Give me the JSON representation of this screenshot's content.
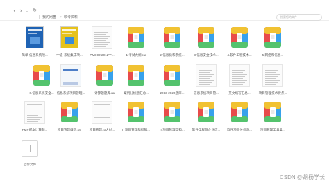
{
  "toolbar": {
    "back_icon": "chevron-left-icon",
    "forward_icon": "chevron-right-icon",
    "dropdown_icon": "chevron-down-icon",
    "refresh_icon": "refresh-icon",
    "breadcrumbs": [
      "我的网盘",
      "软考资料"
    ],
    "search_placeholder": "搜索您的文件"
  },
  "files": [
    {
      "name": "简单·信息系统项...",
      "kind": "book-cover"
    },
    {
      "name": "中级-系统集成项...",
      "kind": "book-cover"
    },
    {
      "name": "PMBOK2012中...",
      "kind": "doc-scan"
    },
    {
      "name": "1.考试大纲.rar",
      "kind": "archive"
    },
    {
      "name": "2.信息化和系统...",
      "kind": "archive"
    },
    {
      "name": "3.信息安全技术...",
      "kind": "archive"
    },
    {
      "name": "4.软件工程技术...",
      "kind": "archive"
    },
    {
      "name": "5.网络和信息...",
      "kind": "archive"
    },
    {
      "name": "6.信息系统安全...",
      "kind": "archive"
    },
    {
      "name": "信息系统项目管理...",
      "kind": "doc-cover"
    },
    {
      "name": "计算题题库.rar",
      "kind": "archive"
    },
    {
      "name": "案例分析题汇总...",
      "kind": "archive"
    },
    {
      "name": "2013-2020题库...",
      "kind": "archive"
    },
    {
      "name": "信息系统项目管...",
      "kind": "doc-scan"
    },
    {
      "name": "英文缩写汇总...",
      "kind": "doc-scan"
    },
    {
      "name": "项目管理技术要点...",
      "kind": "doc-scan"
    },
    {
      "name": "PMP成本计算题...",
      "kind": "doc-scan"
    },
    {
      "name": "项目管理概念.rar",
      "kind": "archive"
    },
    {
      "name": "项目管理10大过...",
      "kind": "doc-grid"
    },
    {
      "name": "IT项目管理基础知...",
      "kind": "archive"
    },
    {
      "name": "IT项目管理全知...",
      "kind": "archive"
    },
    {
      "name": "软件工程与企业信...",
      "kind": "archive"
    },
    {
      "name": "软件项目分析与...",
      "kind": "archive"
    },
    {
      "name": "项目管理工具集...",
      "kind": "archive"
    }
  ],
  "upload": {
    "label": "上传文件",
    "icon": "plus-icon"
  },
  "watermark": "CSDN @胡杨学长",
  "colors": {
    "archive_top": "#f1c232",
    "archive_left": "#e84b4b",
    "archive_right": "#37a1ec",
    "archive_bottom": "#54c36d",
    "book_blue": "#1f63b4",
    "book_yellow": "#e7c21b"
  }
}
